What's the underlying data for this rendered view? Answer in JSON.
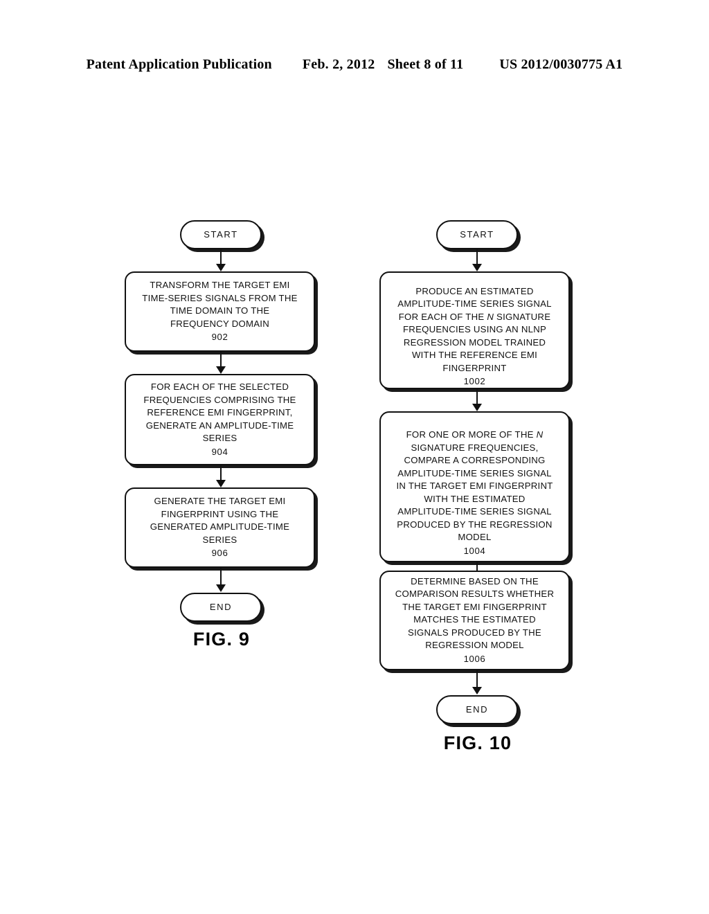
{
  "header": {
    "publication": "Patent Application Publication",
    "date": "Feb. 2, 2012",
    "sheet": "Sheet 8 of 11",
    "patent_number": "US 2012/0030775 A1"
  },
  "figures": [
    {
      "caption": "FIG. 9",
      "nodes": [
        {
          "kind": "terminal",
          "name": "start",
          "text": "START",
          "ref": ""
        },
        {
          "kind": "process",
          "name": "step-902",
          "text": "TRANSFORM THE TARGET EMI\nTIME-SERIES SIGNALS FROM THE\nTIME DOMAIN TO THE\nFREQUENCY DOMAIN",
          "ref": "902"
        },
        {
          "kind": "process",
          "name": "step-904",
          "text": "FOR EACH OF THE SELECTED\nFREQUENCIES COMPRISING THE\nREFERENCE EMI FINGERPRINT,\nGENERATE AN AMPLITUDE-TIME\nSERIES",
          "ref": "904"
        },
        {
          "kind": "process",
          "name": "step-906",
          "text": "GENERATE THE TARGET EMI\nFINGERPRINT USING THE\nGENERATED AMPLITUDE-TIME\nSERIES",
          "ref": "906"
        },
        {
          "kind": "terminal",
          "name": "end",
          "text": "END",
          "ref": ""
        }
      ]
    },
    {
      "caption": "FIG. 10",
      "nodes": [
        {
          "kind": "terminal",
          "name": "start",
          "text": "START",
          "ref": ""
        },
        {
          "kind": "process",
          "name": "step-1002",
          "text_before_italic": "PRODUCE AN ESTIMATED\nAMPLITUDE-TIME SERIES SIGNAL\nFOR EACH OF THE ",
          "italic": "N",
          "text_after_italic": " SIGNATURE\nFREQUENCIES USING AN NLNP\nREGRESSION MODEL TRAINED\nWITH THE REFERENCE EMI\nFINGERPRINT",
          "text": "PRODUCE AN ESTIMATED\nAMPLITUDE-TIME SERIES SIGNAL\nFOR EACH OF THE N SIGNATURE\nFREQUENCIES USING AN NLNP\nREGRESSION MODEL TRAINED\nWITH THE REFERENCE EMI\nFINGERPRINT",
          "ref": "1002"
        },
        {
          "kind": "process",
          "name": "step-1004",
          "text_before_italic": "FOR ONE OR MORE OF THE ",
          "italic": "N",
          "text_after_italic": "\nSIGNATURE FREQUENCIES,\nCOMPARE A CORRESPONDING\nAMPLITUDE-TIME SERIES SIGNAL\nIN THE TARGET EMI FINGERPRINT\nWITH THE ESTIMATED\nAMPLITUDE-TIME SERIES SIGNAL\nPRODUCED BY THE REGRESSION\nMODEL",
          "text": "FOR ONE OR MORE OF THE N\nSIGNATURE FREQUENCIES,\nCOMPARE A CORRESPONDING\nAMPLITUDE-TIME SERIES SIGNAL\nIN THE TARGET EMI FINGERPRINT\nWITH THE ESTIMATED\nAMPLITUDE-TIME SERIES SIGNAL\nPRODUCED BY THE REGRESSION\nMODEL",
          "ref": "1004"
        },
        {
          "kind": "process",
          "name": "step-1006",
          "text": "DETERMINE BASED ON THE\nCOMPARISON RESULTS WHETHER\nTHE TARGET EMI FINGERPRINT\nMATCHES THE ESTIMATED\nSIGNALS PRODUCED BY THE\nREGRESSION MODEL",
          "ref": "1006"
        },
        {
          "kind": "terminal",
          "name": "end",
          "text": "END",
          "ref": ""
        }
      ]
    }
  ]
}
